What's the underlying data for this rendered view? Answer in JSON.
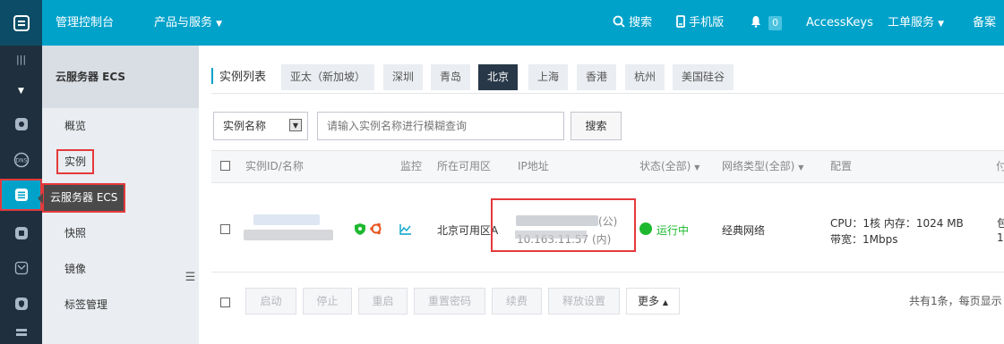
{
  "topbar": {
    "console": "管理控制台",
    "products": "产品与服务",
    "search": "搜索",
    "mobile": "手机版",
    "notif_count": "0",
    "access_keys": "AccessKeys",
    "tickets": "工单服务",
    "record": "备案"
  },
  "subnav": {
    "title": "云服务器 ECS",
    "items": [
      "概览",
      "实例",
      "快照",
      "镜像",
      "标签管理"
    ]
  },
  "tooltip": "云服务器 ECS",
  "regions": {
    "label": "实例列表",
    "tabs": [
      "亚太（新加坡）",
      "深圳",
      "青岛",
      "北京",
      "上海",
      "香港",
      "杭州",
      "美国硅谷"
    ],
    "active": "北京"
  },
  "search": {
    "select_value": "实例名称",
    "placeholder": "请输入实例名称进行模糊查询",
    "button": "搜索"
  },
  "table": {
    "headers": [
      "实例ID/名称",
      "监控",
      "所在可用区",
      "IP地址",
      "状态(全部)",
      "网络类型(全部)",
      "配置",
      "付"
    ],
    "row": {
      "zone": "北京可用区A",
      "ip_public": "(公)",
      "ip_private": "10.163.11.57 (内)",
      "status": "运行中",
      "network": "经典网络",
      "config_line1": "CPU：1核   内存：1024 MB",
      "config_line2": "带宽：1Mbps",
      "trail_1": "包",
      "trail_2": "1"
    }
  },
  "actions": {
    "buttons": [
      "启动",
      "停止",
      "重启",
      "重置密码",
      "续费",
      "释放设置"
    ],
    "more": "更多",
    "pagination": "共有1条，每页显示"
  },
  "colors": {
    "accent": "#00a2ca",
    "rail": "#1f2f3d",
    "highlight": "#e4393c",
    "running": "#1db82f"
  }
}
